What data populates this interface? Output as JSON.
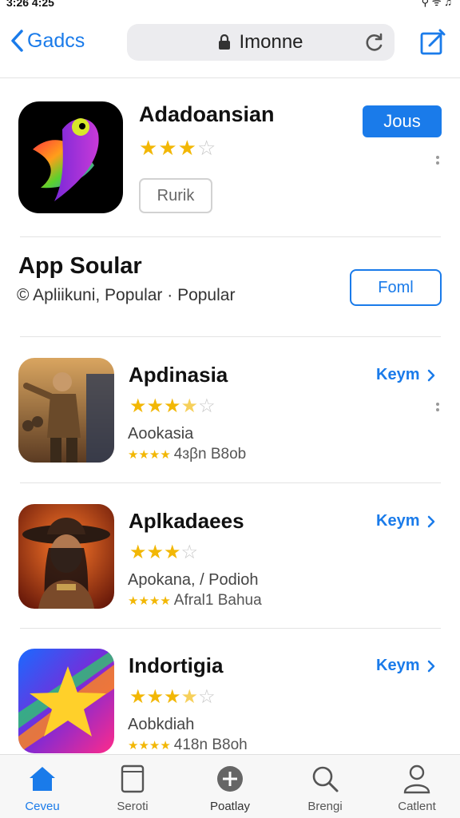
{
  "status_bar": {
    "time": "3:26 4:25",
    "right": "⚲ ᯤ ♫"
  },
  "nav": {
    "back_label": "Gadcs",
    "search_text": "Imonne"
  },
  "featured": {
    "title": "Adadoansian",
    "rating": 3,
    "rank_label": "Rurik",
    "join_label": "Jous"
  },
  "section": {
    "title": "App Soular",
    "subtitle": "© Apliikuni, Popular · Popular",
    "follow_label": "Foml"
  },
  "apps": [
    {
      "title": "Apdinasia",
      "rating": 3.5,
      "sub": "Aookasia",
      "meta": "4ɜβn B8ob",
      "link": "Keym"
    },
    {
      "title": "Aplkadaees",
      "rating": 3,
      "sub": "Apokana, / Podioh",
      "meta": "Afral1 Bahua",
      "link": "Keym"
    },
    {
      "title": "Indortigia",
      "rating": 3.5,
      "sub": "Aobkdiah",
      "meta": "418n B8oh",
      "link": "Keym"
    }
  ],
  "tabs": [
    {
      "label": "Ceveu",
      "icon": "home-icon"
    },
    {
      "label": "Seroti",
      "icon": "tablet-icon"
    },
    {
      "label": "Poatlay",
      "icon": "plus-circle-icon"
    },
    {
      "label": "Brengi",
      "icon": "search-icon"
    },
    {
      "label": "Catlent",
      "icon": "person-icon"
    }
  ],
  "colors": {
    "accent": "#1a7bea",
    "star": "#f2b705"
  }
}
